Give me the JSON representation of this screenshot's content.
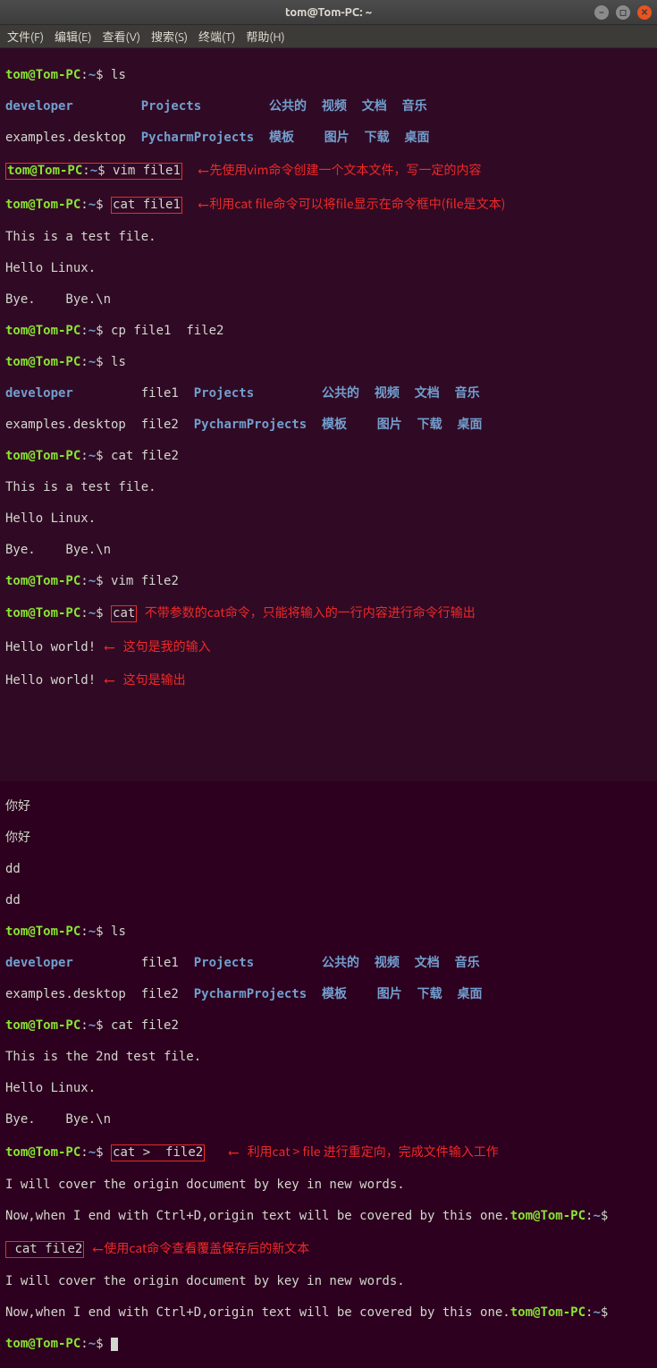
{
  "window": {
    "title": "tom@Tom-PC: ~"
  },
  "menu": {
    "file": "文件(F)",
    "edit": "编辑(E)",
    "view": "查看(V)",
    "search": "搜索(S)",
    "terminal": "终端(T)",
    "help": "帮助(H)"
  },
  "prompt": {
    "user_host": "tom@Tom-PC",
    "path": "~",
    "sep": ":",
    "tail": "$"
  },
  "ls1": {
    "cmd": "ls",
    "c1a": "developer",
    "c1b": "examples.desktop",
    "c2a": "Projects",
    "c2b": "PycharmProjects",
    "c3a": "公共的",
    "c3b": "模板",
    "c4a": "视频",
    "c4b": "图片",
    "c5a": "文档",
    "c5b": "下载",
    "c6a": "音乐",
    "c6b": "桌面"
  },
  "cmds": {
    "vim_file1": "vim file1",
    "cat_file1": "cat file1",
    "cp": "cp file1  file2",
    "ls": "ls",
    "cat_file2": "cat file2",
    "vim_file2": "vim file2",
    "cat_bare": "cat",
    "cat_redir": "cat >  file2",
    "cat_file2b": "cat file2"
  },
  "file1": {
    "l1": "This is a test file.",
    "l2": "Hello Linux.",
    "l3": "Bye.    Bye.\\n"
  },
  "ls2": {
    "c1a": "developer",
    "c1b": "examples.desktop",
    "c2a": "file1",
    "c2b": "file2",
    "c3a": "Projects",
    "c3b": "PycharmProjects",
    "c4a": "公共的",
    "c4b": "模板",
    "c5a": "视频",
    "c5b": "图片",
    "c6a": "文档",
    "c6b": "下载",
    "c7a": "音乐",
    "c7b": "桌面"
  },
  "catio": {
    "in": "Hello world!",
    "out": "Hello world!",
    "nihao1": "你好",
    "nihao2": "你好",
    "dd1": "dd",
    "dd2": "dd"
  },
  "file2v2": {
    "l1": "This is the 2nd test file.",
    "l2": "Hello Linux.",
    "l3": "Bye.    Bye.\\n"
  },
  "file2v3": {
    "l1": "I will cover the origin document by key in new words.",
    "l2a": "Now,when I end with Ctrl+D,origin text will be covered by this one.",
    "l2b": "Now,when I end with Ctrl+D,origin text will be covered by this one."
  },
  "annotations": {
    "a1": "先使用vim命令创建一个文本文件，写一定的内容",
    "a2": "利用cat file命令可以将file显示在命令框中(file是文本)",
    "a3": "不带参数的cat命令，只能将输入的一行内容进行命令行输出",
    "a4": "这句是我的输入",
    "a5": "这句是输出",
    "a6": "利用cat > file 进行重定向，完成文件输入工作",
    "a7": "使用cat命令查看覆盖保存后的新文本"
  }
}
